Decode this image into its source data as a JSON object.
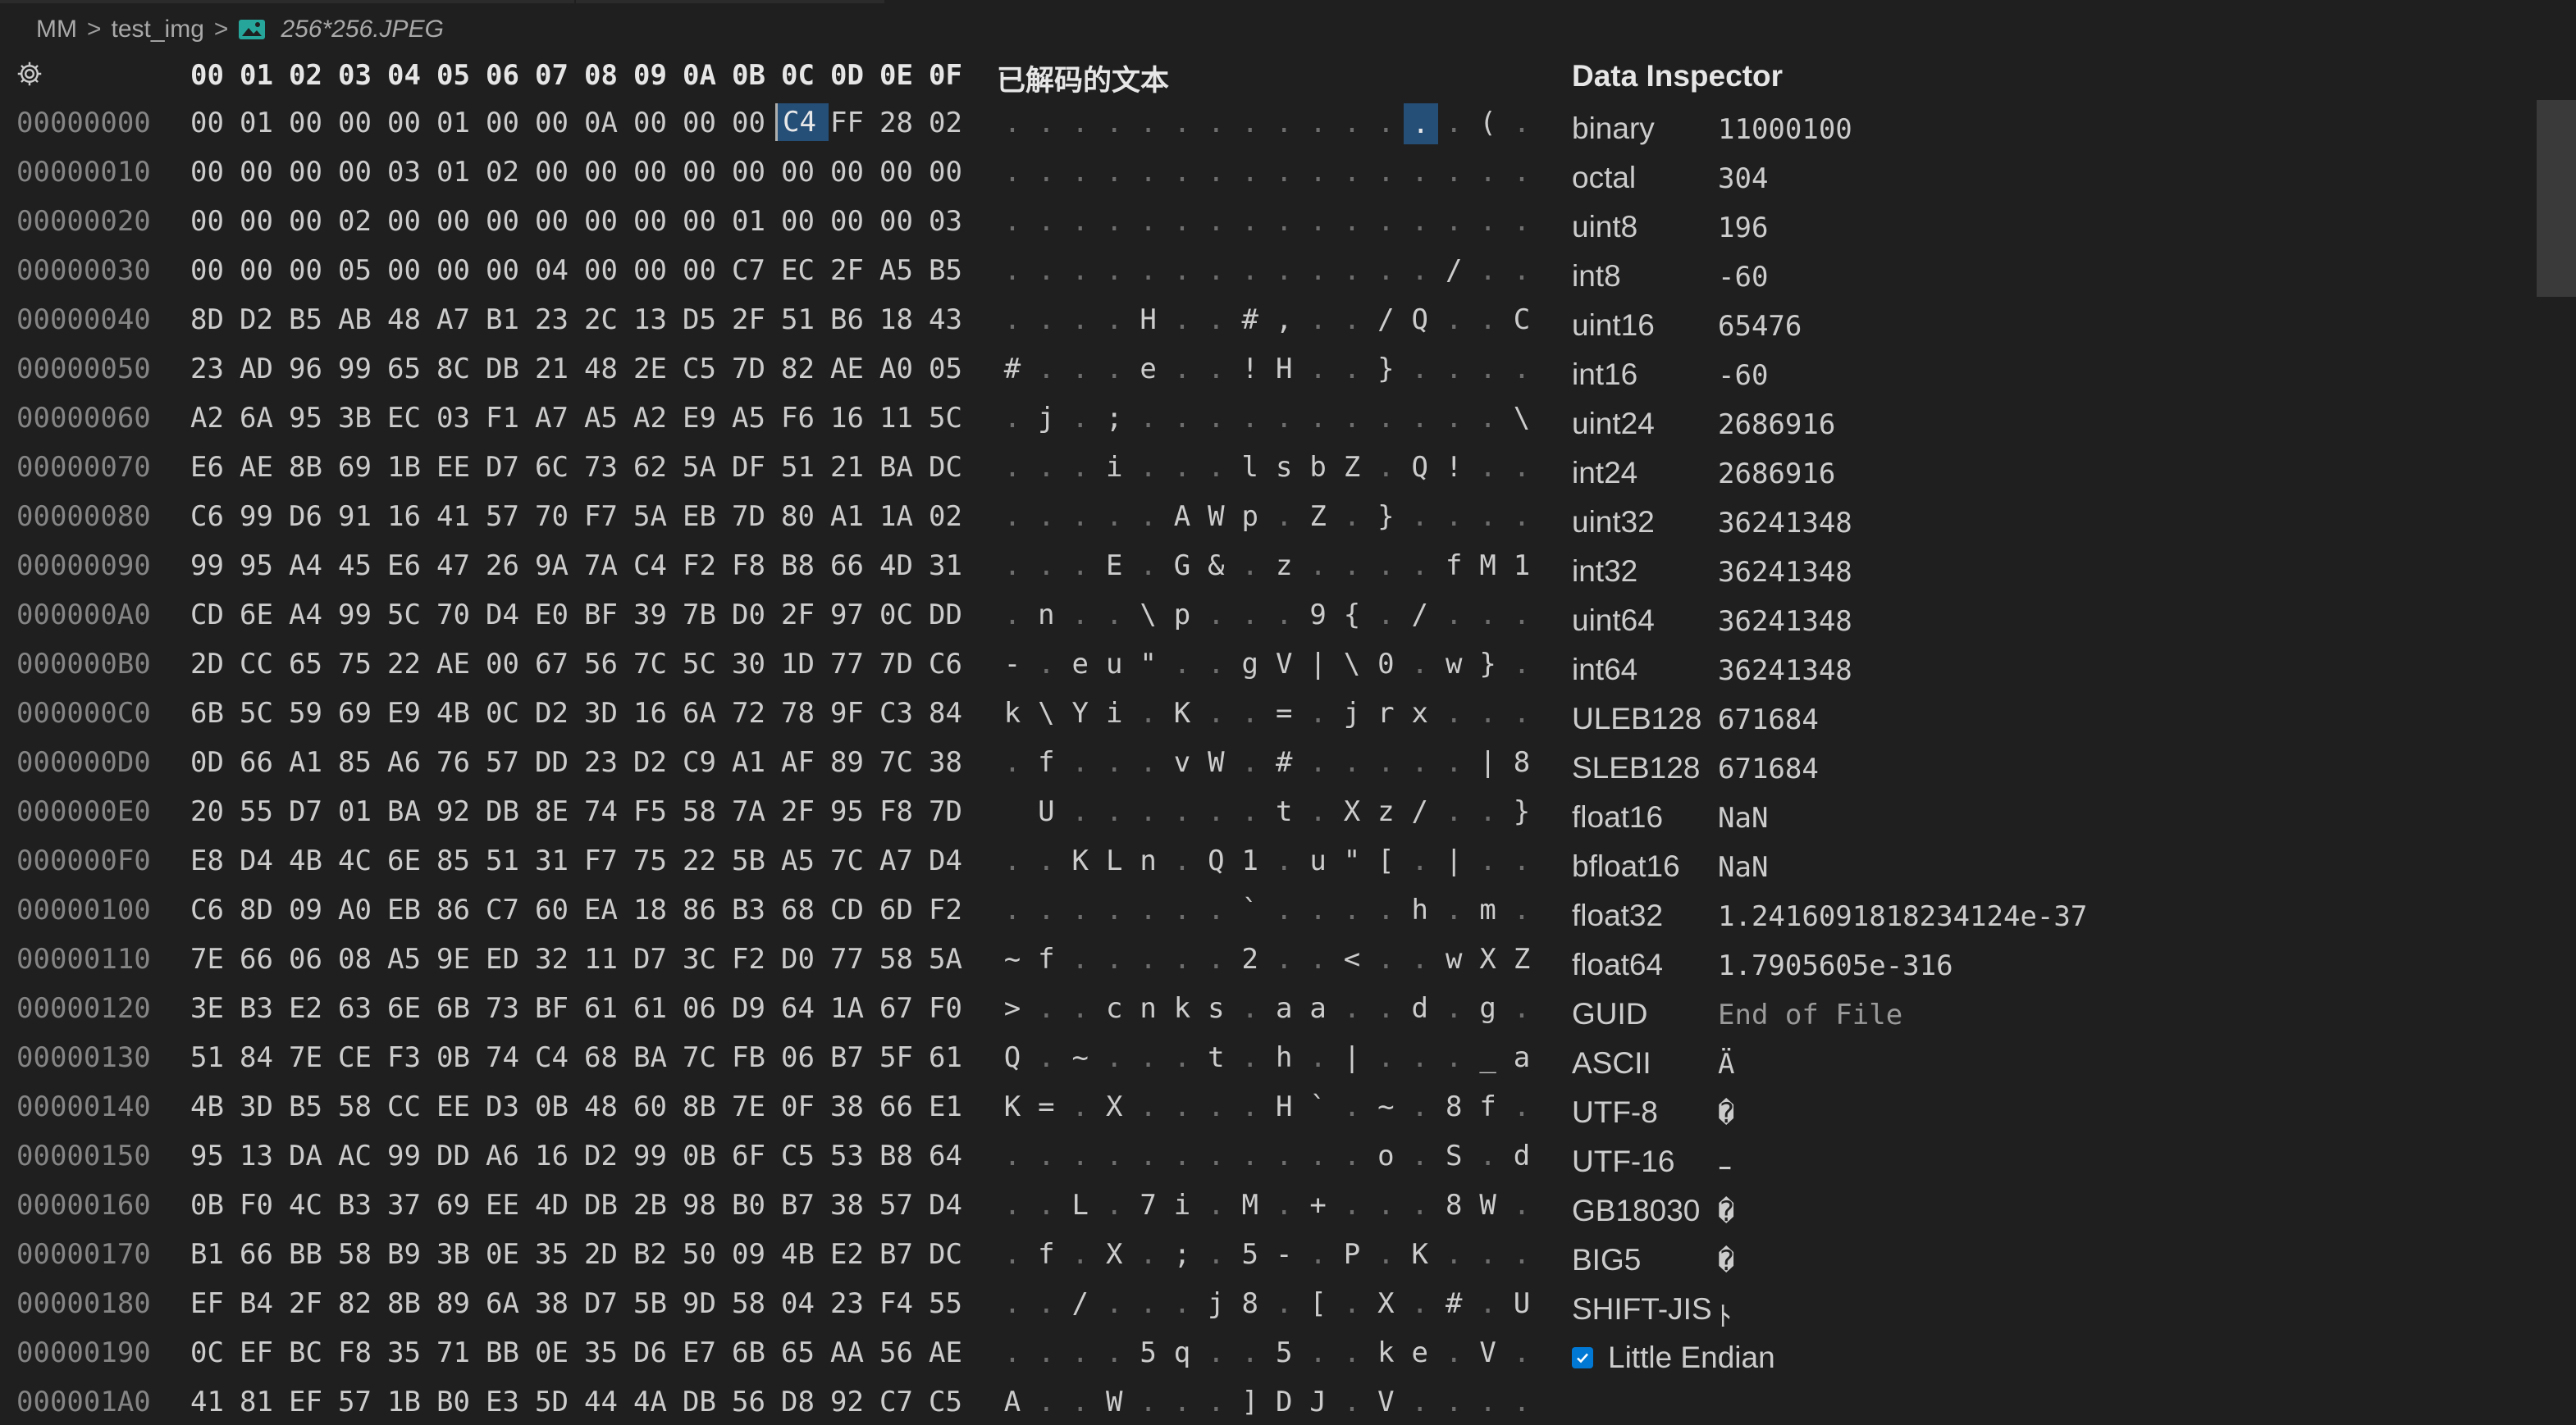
{
  "breadcrumb": {
    "items": [
      "MM",
      "test_img",
      "256*256.JPEG"
    ],
    "separator": ">"
  },
  "header": {
    "hex_columns": [
      "00",
      "01",
      "02",
      "03",
      "04",
      "05",
      "06",
      "07",
      "08",
      "09",
      "0A",
      "0B",
      "0C",
      "0D",
      "0E",
      "0F"
    ],
    "decoded_title": "已解码的文本",
    "inspector_title": "Data Inspector"
  },
  "selection": {
    "row": 0,
    "column": 12,
    "value": "C4"
  },
  "rows": [
    {
      "offset": "00000000",
      "bytes": [
        "00",
        "01",
        "00",
        "00",
        "00",
        "01",
        "00",
        "00",
        "0A",
        "00",
        "00",
        "00",
        "C4",
        "FF",
        "28",
        "02"
      ],
      "decoded": [
        ".",
        ".",
        ".",
        ".",
        ".",
        ".",
        ".",
        ".",
        ".",
        ".",
        ".",
        ".",
        ".",
        ".",
        "(",
        "."
      ]
    },
    {
      "offset": "00000010",
      "bytes": [
        "00",
        "00",
        "00",
        "00",
        "03",
        "01",
        "02",
        "00",
        "00",
        "00",
        "00",
        "00",
        "00",
        "00",
        "00",
        "00"
      ],
      "decoded": [
        ".",
        ".",
        ".",
        ".",
        ".",
        ".",
        ".",
        ".",
        ".",
        ".",
        ".",
        ".",
        ".",
        ".",
        ".",
        "."
      ]
    },
    {
      "offset": "00000020",
      "bytes": [
        "00",
        "00",
        "00",
        "02",
        "00",
        "00",
        "00",
        "00",
        "00",
        "00",
        "00",
        "01",
        "00",
        "00",
        "00",
        "03"
      ],
      "decoded": [
        ".",
        ".",
        ".",
        ".",
        ".",
        ".",
        ".",
        ".",
        ".",
        ".",
        ".",
        ".",
        ".",
        ".",
        ".",
        "."
      ]
    },
    {
      "offset": "00000030",
      "bytes": [
        "00",
        "00",
        "00",
        "05",
        "00",
        "00",
        "00",
        "04",
        "00",
        "00",
        "00",
        "C7",
        "EC",
        "2F",
        "A5",
        "B5"
      ],
      "decoded": [
        ".",
        ".",
        ".",
        ".",
        ".",
        ".",
        ".",
        ".",
        ".",
        ".",
        ".",
        ".",
        ".",
        "/",
        ".",
        "."
      ]
    },
    {
      "offset": "00000040",
      "bytes": [
        "8D",
        "D2",
        "B5",
        "AB",
        "48",
        "A7",
        "B1",
        "23",
        "2C",
        "13",
        "D5",
        "2F",
        "51",
        "B6",
        "18",
        "43"
      ],
      "decoded": [
        ".",
        ".",
        ".",
        ".",
        "H",
        ".",
        ".",
        "#",
        ",",
        ".",
        ".",
        "/",
        "Q",
        ".",
        ".",
        "C"
      ]
    },
    {
      "offset": "00000050",
      "bytes": [
        "23",
        "AD",
        "96",
        "99",
        "65",
        "8C",
        "DB",
        "21",
        "48",
        "2E",
        "C5",
        "7D",
        "82",
        "AE",
        "A0",
        "05"
      ],
      "decoded": [
        "#",
        ".",
        ".",
        ".",
        "e",
        ".",
        ".",
        "!",
        "H",
        ".",
        ".",
        "}",
        ".",
        ".",
        ".",
        "."
      ]
    },
    {
      "offset": "00000060",
      "bytes": [
        "A2",
        "6A",
        "95",
        "3B",
        "EC",
        "03",
        "F1",
        "A7",
        "A5",
        "A2",
        "E9",
        "A5",
        "F6",
        "16",
        "11",
        "5C"
      ],
      "decoded": [
        ".",
        "j",
        ".",
        ";",
        ".",
        ".",
        ".",
        ".",
        ".",
        ".",
        ".",
        ".",
        ".",
        ".",
        ".",
        "\\"
      ]
    },
    {
      "offset": "00000070",
      "bytes": [
        "E6",
        "AE",
        "8B",
        "69",
        "1B",
        "EE",
        "D7",
        "6C",
        "73",
        "62",
        "5A",
        "DF",
        "51",
        "21",
        "BA",
        "DC"
      ],
      "decoded": [
        ".",
        ".",
        ".",
        "i",
        ".",
        ".",
        ".",
        "l",
        "s",
        "b",
        "Z",
        ".",
        "Q",
        "!",
        ".",
        "."
      ]
    },
    {
      "offset": "00000080",
      "bytes": [
        "C6",
        "99",
        "D6",
        "91",
        "16",
        "41",
        "57",
        "70",
        "F7",
        "5A",
        "EB",
        "7D",
        "80",
        "A1",
        "1A",
        "02"
      ],
      "decoded": [
        ".",
        ".",
        ".",
        ".",
        ".",
        "A",
        "W",
        "p",
        ".",
        "Z",
        ".",
        "}",
        ".",
        ".",
        ".",
        "."
      ]
    },
    {
      "offset": "00000090",
      "bytes": [
        "99",
        "95",
        "A4",
        "45",
        "E6",
        "47",
        "26",
        "9A",
        "7A",
        "C4",
        "F2",
        "F8",
        "B8",
        "66",
        "4D",
        "31"
      ],
      "decoded": [
        ".",
        ".",
        ".",
        "E",
        ".",
        "G",
        "&",
        ".",
        "z",
        ".",
        ".",
        ".",
        ".",
        "f",
        "M",
        "1"
      ]
    },
    {
      "offset": "000000A0",
      "bytes": [
        "CD",
        "6E",
        "A4",
        "99",
        "5C",
        "70",
        "D4",
        "E0",
        "BF",
        "39",
        "7B",
        "D0",
        "2F",
        "97",
        "0C",
        "DD"
      ],
      "decoded": [
        ".",
        "n",
        ".",
        ".",
        "\\",
        "p",
        ".",
        ".",
        ".",
        "9",
        "{",
        ".",
        "/",
        ".",
        ".",
        "."
      ]
    },
    {
      "offset": "000000B0",
      "bytes": [
        "2D",
        "CC",
        "65",
        "75",
        "22",
        "AE",
        "00",
        "67",
        "56",
        "7C",
        "5C",
        "30",
        "1D",
        "77",
        "7D",
        "C6"
      ],
      "decoded": [
        "-",
        ".",
        "e",
        "u",
        "\"",
        ".",
        ".",
        "g",
        "V",
        "|",
        "\\",
        "0",
        ".",
        "w",
        "}",
        "."
      ]
    },
    {
      "offset": "000000C0",
      "bytes": [
        "6B",
        "5C",
        "59",
        "69",
        "E9",
        "4B",
        "0C",
        "D2",
        "3D",
        "16",
        "6A",
        "72",
        "78",
        "9F",
        "C3",
        "84"
      ],
      "decoded": [
        "k",
        "\\",
        "Y",
        "i",
        ".",
        "K",
        ".",
        ".",
        "=",
        ".",
        "j",
        "r",
        "x",
        ".",
        ".",
        "."
      ]
    },
    {
      "offset": "000000D0",
      "bytes": [
        "0D",
        "66",
        "A1",
        "85",
        "A6",
        "76",
        "57",
        "DD",
        "23",
        "D2",
        "C9",
        "A1",
        "AF",
        "89",
        "7C",
        "38"
      ],
      "decoded": [
        ".",
        "f",
        ".",
        ".",
        ".",
        "v",
        "W",
        ".",
        "#",
        ".",
        ".",
        ".",
        ".",
        ".",
        "|",
        "8"
      ]
    },
    {
      "offset": "000000E0",
      "bytes": [
        "20",
        "55",
        "D7",
        "01",
        "BA",
        "92",
        "DB",
        "8E",
        "74",
        "F5",
        "58",
        "7A",
        "2F",
        "95",
        "F8",
        "7D"
      ],
      "decoded": [
        " ",
        "U",
        ".",
        ".",
        ".",
        ".",
        ".",
        ".",
        "t",
        ".",
        "X",
        "z",
        "/",
        ".",
        ".",
        "}"
      ]
    },
    {
      "offset": "000000F0",
      "bytes": [
        "E8",
        "D4",
        "4B",
        "4C",
        "6E",
        "85",
        "51",
        "31",
        "F7",
        "75",
        "22",
        "5B",
        "A5",
        "7C",
        "A7",
        "D4"
      ],
      "decoded": [
        ".",
        ".",
        "K",
        "L",
        "n",
        ".",
        "Q",
        "1",
        ".",
        "u",
        "\"",
        "[",
        ".",
        "|",
        ".",
        "."
      ]
    },
    {
      "offset": "00000100",
      "bytes": [
        "C6",
        "8D",
        "09",
        "A0",
        "EB",
        "86",
        "C7",
        "60",
        "EA",
        "18",
        "86",
        "B3",
        "68",
        "CD",
        "6D",
        "F2"
      ],
      "decoded": [
        ".",
        ".",
        ".",
        ".",
        ".",
        ".",
        ".",
        "`",
        ".",
        ".",
        ".",
        ".",
        "h",
        ".",
        "m",
        "."
      ]
    },
    {
      "offset": "00000110",
      "bytes": [
        "7E",
        "66",
        "06",
        "08",
        "A5",
        "9E",
        "ED",
        "32",
        "11",
        "D7",
        "3C",
        "F2",
        "D0",
        "77",
        "58",
        "5A"
      ],
      "decoded": [
        "~",
        "f",
        ".",
        ".",
        ".",
        ".",
        ".",
        "2",
        ".",
        ".",
        "<",
        ".",
        ".",
        "w",
        "X",
        "Z"
      ]
    },
    {
      "offset": "00000120",
      "bytes": [
        "3E",
        "B3",
        "E2",
        "63",
        "6E",
        "6B",
        "73",
        "BF",
        "61",
        "61",
        "06",
        "D9",
        "64",
        "1A",
        "67",
        "F0"
      ],
      "decoded": [
        ">",
        ".",
        ".",
        "c",
        "n",
        "k",
        "s",
        ".",
        "a",
        "a",
        ".",
        ".",
        "d",
        ".",
        "g",
        "."
      ]
    },
    {
      "offset": "00000130",
      "bytes": [
        "51",
        "84",
        "7E",
        "CE",
        "F3",
        "0B",
        "74",
        "C4",
        "68",
        "BA",
        "7C",
        "FB",
        "06",
        "B7",
        "5F",
        "61"
      ],
      "decoded": [
        "Q",
        ".",
        "~",
        ".",
        ".",
        ".",
        "t",
        ".",
        "h",
        ".",
        "|",
        ".",
        ".",
        ".",
        "_",
        "a"
      ]
    },
    {
      "offset": "00000140",
      "bytes": [
        "4B",
        "3D",
        "B5",
        "58",
        "CC",
        "EE",
        "D3",
        "0B",
        "48",
        "60",
        "8B",
        "7E",
        "0F",
        "38",
        "66",
        "E1"
      ],
      "decoded": [
        "K",
        "=",
        ".",
        "X",
        ".",
        ".",
        ".",
        ".",
        "H",
        "`",
        ".",
        "~",
        ".",
        "8",
        "f",
        "."
      ]
    },
    {
      "offset": "00000150",
      "bytes": [
        "95",
        "13",
        "DA",
        "AC",
        "99",
        "DD",
        "A6",
        "16",
        "D2",
        "99",
        "0B",
        "6F",
        "C5",
        "53",
        "B8",
        "64"
      ],
      "decoded": [
        ".",
        ".",
        ".",
        ".",
        ".",
        ".",
        ".",
        ".",
        ".",
        ".",
        ".",
        "o",
        ".",
        "S",
        ".",
        "d"
      ]
    },
    {
      "offset": "00000160",
      "bytes": [
        "0B",
        "F0",
        "4C",
        "B3",
        "37",
        "69",
        "EE",
        "4D",
        "DB",
        "2B",
        "98",
        "B0",
        "B7",
        "38",
        "57",
        "D4"
      ],
      "decoded": [
        ".",
        ".",
        "L",
        ".",
        "7",
        "i",
        ".",
        "M",
        ".",
        "+",
        ".",
        ".",
        ".",
        "8",
        "W",
        "."
      ]
    },
    {
      "offset": "00000170",
      "bytes": [
        "B1",
        "66",
        "BB",
        "58",
        "B9",
        "3B",
        "0E",
        "35",
        "2D",
        "B2",
        "50",
        "09",
        "4B",
        "E2",
        "B7",
        "DC"
      ],
      "decoded": [
        ".",
        "f",
        ".",
        "X",
        ".",
        ";",
        ".",
        "5",
        "-",
        ".",
        "P",
        ".",
        "K",
        ".",
        ".",
        "."
      ]
    },
    {
      "offset": "00000180",
      "bytes": [
        "EF",
        "B4",
        "2F",
        "82",
        "8B",
        "89",
        "6A",
        "38",
        "D7",
        "5B",
        "9D",
        "58",
        "04",
        "23",
        "F4",
        "55"
      ],
      "decoded": [
        ".",
        ".",
        "/",
        ".",
        ".",
        ".",
        "j",
        "8",
        ".",
        "[",
        ".",
        "X",
        ".",
        "#",
        ".",
        "U"
      ]
    },
    {
      "offset": "00000190",
      "bytes": [
        "0C",
        "EF",
        "BC",
        "F8",
        "35",
        "71",
        "BB",
        "0E",
        "35",
        "D6",
        "E7",
        "6B",
        "65",
        "AA",
        "56",
        "AE"
      ],
      "decoded": [
        ".",
        ".",
        ".",
        ".",
        "5",
        "q",
        ".",
        ".",
        "5",
        ".",
        ".",
        "k",
        "e",
        ".",
        "V",
        "."
      ]
    },
    {
      "offset": "000001A0",
      "bytes": [
        "41",
        "81",
        "EF",
        "57",
        "1B",
        "B0",
        "E3",
        "5D",
        "44",
        "4A",
        "DB",
        "56",
        "D8",
        "92",
        "C7",
        "C5"
      ],
      "decoded": [
        "A",
        ".",
        ".",
        "W",
        ".",
        ".",
        ".",
        "]",
        "D",
        "J",
        ".",
        "V",
        ".",
        ".",
        ".",
        "."
      ]
    }
  ],
  "inspector": [
    {
      "label": "binary",
      "value": "11000100"
    },
    {
      "label": "octal",
      "value": "304"
    },
    {
      "label": "uint8",
      "value": "196"
    },
    {
      "label": "int8",
      "value": "-60"
    },
    {
      "label": "uint16",
      "value": "65476"
    },
    {
      "label": "int16",
      "value": "-60"
    },
    {
      "label": "uint24",
      "value": "2686916"
    },
    {
      "label": "int24",
      "value": "2686916"
    },
    {
      "label": "uint32",
      "value": "36241348"
    },
    {
      "label": "int32",
      "value": "36241348"
    },
    {
      "label": "uint64",
      "value": "36241348"
    },
    {
      "label": "int64",
      "value": "36241348"
    },
    {
      "label": "ULEB128",
      "value": "671684"
    },
    {
      "label": "SLEB128",
      "value": "671684"
    },
    {
      "label": "float16",
      "value": "NaN"
    },
    {
      "label": "bfloat16",
      "value": "NaN"
    },
    {
      "label": "float32",
      "value": "1.2416091818234124e-37"
    },
    {
      "label": "float64",
      "value": "1.7905605e-316"
    },
    {
      "label": "GUID",
      "value": "End of File",
      "dim": true
    },
    {
      "label": "ASCII",
      "value": "Ä"
    },
    {
      "label": "UTF-8",
      "value": "�"
    },
    {
      "label": "UTF-16",
      "value": "ｰ"
    },
    {
      "label": "GB18030",
      "value": "�"
    },
    {
      "label": "BIG5",
      "value": "�"
    },
    {
      "label": "SHIFT-JIS",
      "value": "ﾄ"
    }
  ],
  "little_endian": {
    "label": "Little Endian",
    "checked": true
  },
  "icons": {
    "settings": "gear-icon",
    "file": "image-file-icon",
    "checkbox": "checkmark-icon"
  },
  "colors": {
    "background": "#1f1f1f",
    "selection": "#264f78",
    "offset": "#858585",
    "text": "#cccccc",
    "checkbox": "#0078d4",
    "file_icon": "#26a69a"
  }
}
